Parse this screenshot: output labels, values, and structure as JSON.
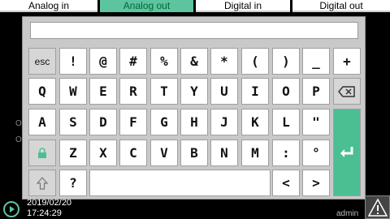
{
  "tabs": [
    {
      "label": "Analog in",
      "active": false
    },
    {
      "label": "Analog out",
      "active": true
    },
    {
      "label": "Digital in",
      "active": false
    },
    {
      "label": "Digital out",
      "active": false
    }
  ],
  "background": {
    "left_text_1": "O",
    "left_text_2": "O"
  },
  "keyboard": {
    "input_value": "",
    "row1": [
      "esc",
      "!",
      "@",
      "#",
      "%",
      "&",
      "*",
      "(",
      ")",
      "_",
      "+"
    ],
    "row2": [
      "Q",
      "W",
      "E",
      "R",
      "T",
      "Y",
      "U",
      "I",
      "O",
      "P"
    ],
    "row3": [
      "A",
      "S",
      "D",
      "F",
      "G",
      "H",
      "J",
      "K",
      "L",
      "\""
    ],
    "row4": [
      "Z",
      "X",
      "C",
      "V",
      "B",
      "N",
      "M",
      ":",
      "°"
    ],
    "row5": [
      "?",
      "<",
      ">"
    ]
  },
  "status": {
    "date": "2019/02/20",
    "time": "17:24:29",
    "user": "admin"
  },
  "colors": {
    "accent": "#5ec39f",
    "enter_key": "#4bbf92"
  }
}
